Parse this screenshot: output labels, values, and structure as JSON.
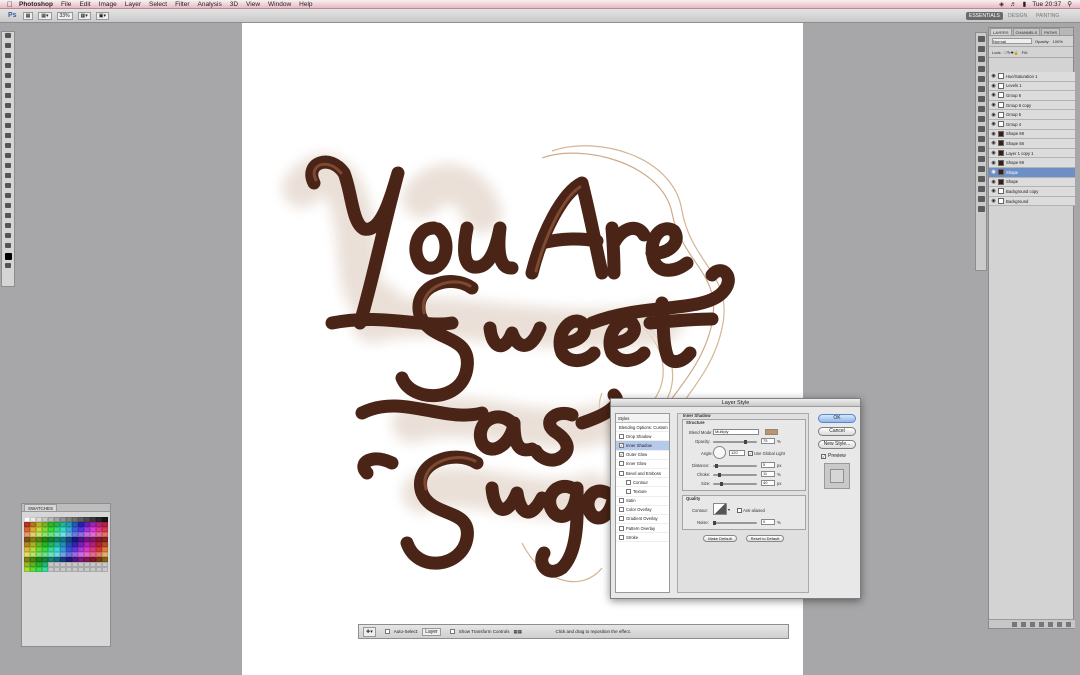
{
  "menubar": {
    "app_name": "Photoshop",
    "items": [
      "File",
      "Edit",
      "Image",
      "Layer",
      "Select",
      "Filter",
      "Analysis",
      "3D",
      "View",
      "Window",
      "Help"
    ],
    "clock": "Tue 20:37"
  },
  "optionsbar": {
    "logo": "Ps",
    "zoom": "33%",
    "workspaces": [
      "ESSENTIALS",
      "DESIGN",
      "PAINTING"
    ]
  },
  "layers_panel": {
    "tabs": [
      "LAYERS",
      "CHANNELS",
      "PATHS"
    ],
    "blend_mode": "Normal",
    "opacity_label": "Opacity:",
    "opacity_value": "100%",
    "fill_label": "Fill:",
    "lock_label": "Lock:",
    "layers": [
      {
        "name": "Hue/Saturation 1"
      },
      {
        "name": "Levels 1"
      },
      {
        "name": "Group 6"
      },
      {
        "name": "Group 6 copy"
      },
      {
        "name": "Group 5"
      },
      {
        "name": "Group 4"
      },
      {
        "name": "Shape 69"
      },
      {
        "name": "Shape 56"
      },
      {
        "name": "Layer 1 copy 1"
      },
      {
        "name": "Shape 69"
      },
      {
        "name": "Shape"
      },
      {
        "name": "Shape"
      },
      {
        "name": "Background copy"
      },
      {
        "name": "Background"
      }
    ]
  },
  "swatches_panel": {
    "tab": "SWATCHES"
  },
  "dialog": {
    "title": "Layer Style",
    "styles_header": "Styles",
    "blending_options": "Blending Options: Custom",
    "style_items": [
      {
        "label": "Drop Shadow",
        "checked": false,
        "sub": false
      },
      {
        "label": "Inner Shadow",
        "checked": true,
        "sub": false,
        "selected": true
      },
      {
        "label": "Outer Glow",
        "checked": true,
        "sub": false
      },
      {
        "label": "Inner Glow",
        "checked": false,
        "sub": false
      },
      {
        "label": "Bevel and Emboss",
        "checked": false,
        "sub": false
      },
      {
        "label": "Contour",
        "checked": false,
        "sub": true
      },
      {
        "label": "Texture",
        "checked": false,
        "sub": true
      },
      {
        "label": "Satin",
        "checked": false,
        "sub": false
      },
      {
        "label": "Color Overlay",
        "checked": false,
        "sub": false
      },
      {
        "label": "Gradient Overlay",
        "checked": false,
        "sub": false
      },
      {
        "label": "Pattern Overlay",
        "checked": false,
        "sub": false
      },
      {
        "label": "Stroke",
        "checked": false,
        "sub": false
      }
    ],
    "section_title": "Inner Shadow",
    "structure_label": "Structure",
    "blend_mode_label": "Blend Mode:",
    "blend_mode_value": "Multiply",
    "opacity_label": "Opacity:",
    "opacity_value": "75",
    "angle_label": "Angle:",
    "angle_value": "120",
    "global_light_label": "Use Global Light",
    "distance_label": "Distance:",
    "distance_value": "5",
    "choke_label": "Choke:",
    "choke_value": "11",
    "size_label": "Size:",
    "size_value": "40",
    "percent": "%",
    "px": "px",
    "quality_label": "Quality",
    "contour_label": "Contour:",
    "antialiased_label": "Anti-aliased",
    "noise_label": "Noise:",
    "noise_value": "0",
    "make_default": "Make Default",
    "reset_default": "Reset to Default",
    "ok": "OK",
    "cancel": "Cancel",
    "new_style": "New Style...",
    "preview": "Preview",
    "shadow_color": "#c09468"
  },
  "movebar": {
    "auto_select": "Auto-Select:",
    "auto_select_value": "Layer",
    "show_transform": "Show Transform Controls",
    "hint": "Click and drag to reposition the effect."
  },
  "colors": {
    "chocolate": "#4a2416",
    "highlight": "#8a5237",
    "outline": "#c9a27b"
  }
}
